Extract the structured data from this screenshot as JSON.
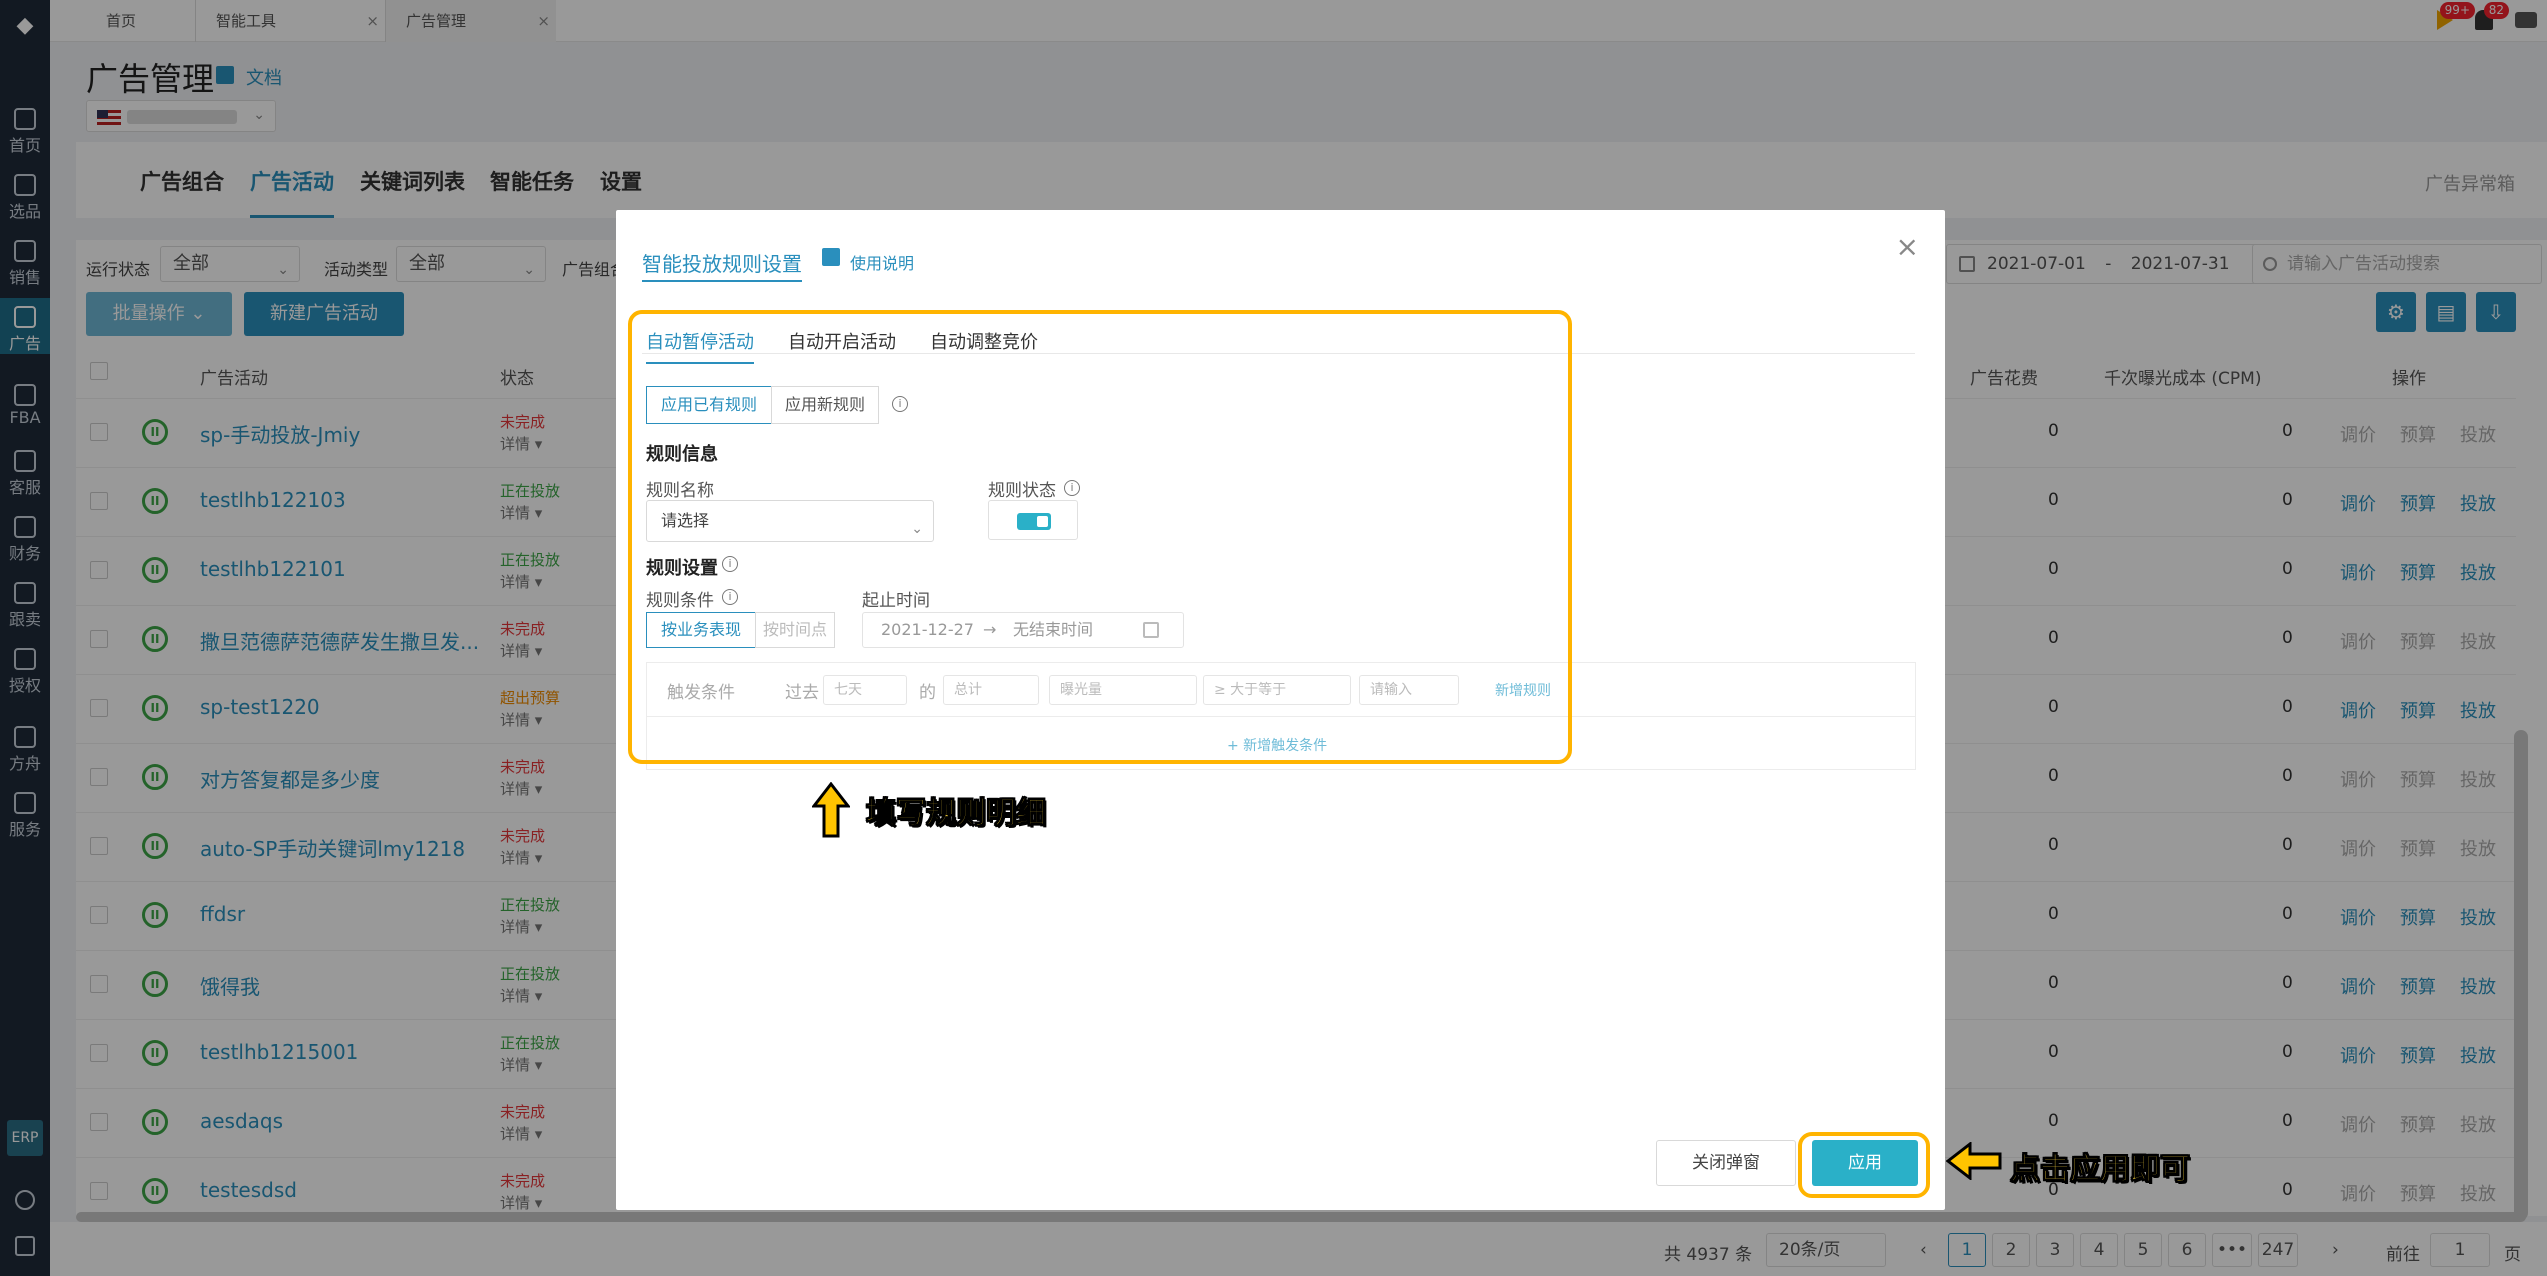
{
  "sidebar": {
    "items": [
      {
        "label": "首页",
        "icon": "home-icon"
      },
      {
        "label": "选品",
        "icon": "search-icon"
      },
      {
        "label": "销售",
        "icon": "trend-icon"
      },
      {
        "label": "广告",
        "icon": "ad-icon"
      },
      {
        "label": "FBA",
        "icon": "warehouse-icon"
      },
      {
        "label": "客服",
        "icon": "chat-icon"
      },
      {
        "label": "财务",
        "icon": "money-icon"
      },
      {
        "label": "跟卖",
        "icon": "pie-icon"
      },
      {
        "label": "授权",
        "icon": "shield-icon"
      },
      {
        "label": "方舟",
        "icon": "ark-icon"
      },
      {
        "label": "服务",
        "icon": "service-icon"
      }
    ],
    "erp": "ERP"
  },
  "tabs": {
    "home": "首页",
    "tools": "智能工具",
    "ads": "广告管理"
  },
  "topright": {
    "badge1": "99+",
    "badge2": "82"
  },
  "header": {
    "title": "广告管理",
    "doc": "文档"
  },
  "main_tabs": [
    "广告组合",
    "广告活动",
    "关键词列表",
    "智能任务",
    "设置"
  ],
  "ad_anomaly": "广告异常箱",
  "filters": {
    "run_status_label": "运行状态",
    "run_status_value": "全部",
    "type_label": "活动类型",
    "type_value": "全部",
    "group_label": "广告组合",
    "date_start": "2021-07-01",
    "date_sep": "-",
    "date_end": "2021-07-31",
    "search_placeholder": "请输入广告活动搜索",
    "bulk": "批量操作",
    "new_campaign": "新建广告活动"
  },
  "table": {
    "headers": {
      "campaign": "广告活动",
      "status": "状态",
      "spend": "广告花费",
      "cpm": "千次曝光成本 (CPM)",
      "ops": "操作"
    },
    "detail": "详情",
    "actions": [
      "调价",
      "预算",
      "投放"
    ],
    "rows": [
      {
        "name": "sp-手动投放-Jmiy",
        "status": "未完成",
        "tone": "red",
        "spend": "0",
        "cpm": "0",
        "enabled": false
      },
      {
        "name": "testlhb122103",
        "status": "正在投放",
        "tone": "green",
        "spend": "0",
        "cpm": "0",
        "enabled": true
      },
      {
        "name": "testlhb122101",
        "status": "正在投放",
        "tone": "green",
        "spend": "0",
        "cpm": "0",
        "enabled": true
      },
      {
        "name": "撒旦范德萨范德萨发生撒旦发...",
        "status": "未完成",
        "tone": "red",
        "spend": "0",
        "cpm": "0",
        "enabled": false
      },
      {
        "name": "sp-test1220",
        "status": "超出预算",
        "tone": "orange",
        "spend": "0",
        "cpm": "0",
        "enabled": true
      },
      {
        "name": "对方答复都是多少度",
        "status": "未完成",
        "tone": "red",
        "spend": "0",
        "cpm": "0",
        "enabled": false
      },
      {
        "name": "auto-SP手动关键词lmy1218",
        "status": "未完成",
        "tone": "red",
        "spend": "0",
        "cpm": "0",
        "enabled": false
      },
      {
        "name": "ffdsr",
        "status": "正在投放",
        "tone": "green",
        "spend": "0",
        "cpm": "0",
        "enabled": true
      },
      {
        "name": "饿得我",
        "status": "正在投放",
        "tone": "green",
        "spend": "0",
        "cpm": "0",
        "enabled": true
      },
      {
        "name": "testlhb1215001",
        "status": "正在投放",
        "tone": "green",
        "spend": "0",
        "cpm": "0",
        "enabled": true
      },
      {
        "name": "aesdaqs",
        "status": "未完成",
        "tone": "red",
        "spend": "0",
        "cpm": "0",
        "enabled": false
      },
      {
        "name": "testesdsd",
        "status": "未完成",
        "tone": "red",
        "spend": "0",
        "cpm": "0",
        "enabled": false
      }
    ]
  },
  "pager": {
    "total": "共 4937 条",
    "page_size": "20条/页",
    "pages": [
      "1",
      "2",
      "3",
      "4",
      "5",
      "6",
      "•••",
      "247"
    ],
    "goto_label": "前往",
    "goto_value": "1",
    "page_unit": "页",
    "prev": "‹",
    "next": "›"
  },
  "modal": {
    "title": "智能投放规则设置",
    "help": "使用说明",
    "tabs": [
      "自动暂停活动",
      "自动开启活动",
      "自动调整竞价"
    ],
    "seg_existing": "应用已有规则",
    "seg_new": "应用新规则",
    "info": "i",
    "rule_info": "规则信息",
    "rule_name_label": "规则名称",
    "rule_name_placeholder": "请选择",
    "rule_status_label": "规则状态",
    "rule_settings": "规则设置",
    "cond_label": "规则条件",
    "by_business": "按业务表现",
    "by_time": "按时间点",
    "period_label": "起止时间",
    "date_start": "2021-12-27",
    "date_arrow": "→",
    "date_end": "无结束时间",
    "trigger_label": "触发条件",
    "past": "过去",
    "days": "七天",
    "of": "的",
    "agg": "总计",
    "metric": "曝光量",
    "op": "≥ 大于等于",
    "input_placeholder": "请输入",
    "new_rule": "新增规则",
    "add_trigger": "+ 新增触发条件",
    "close": "关闭弹窗",
    "apply": "应用"
  },
  "annotations": {
    "fill_detail": "填写规则明细",
    "click_apply": "点击应用即可"
  },
  "colors": {
    "accent": "#2a8fbd",
    "highlight": "#ffb400",
    "callout_text": "#ffd83d",
    "apply_button": "#2ab0c8"
  }
}
